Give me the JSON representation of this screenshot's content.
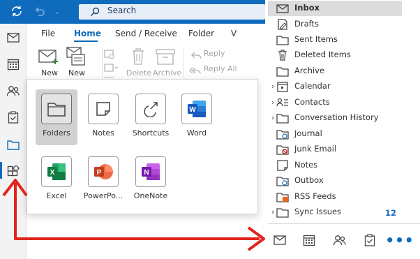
{
  "search": {
    "label": "Search"
  },
  "ribbon": {
    "tabs": [
      "File",
      "Home",
      "Send / Receive",
      "Folder",
      "V"
    ],
    "commands": {
      "new_email": "New",
      "new_items": "New",
      "delete": "Delete",
      "archive": "Archive",
      "reply": "Reply",
      "reply_all": "Reply All"
    }
  },
  "apps": [
    {
      "name": "Folders",
      "selected": true
    },
    {
      "name": "Notes"
    },
    {
      "name": "Shortcuts"
    },
    {
      "name": "Word"
    },
    {
      "name": "Excel"
    },
    {
      "name": "PowerPo..."
    },
    {
      "name": "OneNote"
    }
  ],
  "folders": [
    {
      "name": "Inbox",
      "selected": true
    },
    {
      "name": "Drafts"
    },
    {
      "name": "Sent Items"
    },
    {
      "name": "Deleted Items"
    },
    {
      "name": "Archive"
    },
    {
      "name": "Calendar",
      "expandable": true
    },
    {
      "name": "Contacts",
      "expandable": true
    },
    {
      "name": "Conversation History",
      "expandable": true
    },
    {
      "name": "Journal"
    },
    {
      "name": "Junk Email"
    },
    {
      "name": "Notes"
    },
    {
      "name": "Outbox"
    },
    {
      "name": "RSS Feeds"
    },
    {
      "name": "Sync Issues",
      "expandable": true,
      "count": "12"
    }
  ],
  "bottom_nav": {
    "more": "•••"
  },
  "colors": {
    "brand_blue": "#0f6cbd",
    "arrow_red": "#e2231a"
  }
}
